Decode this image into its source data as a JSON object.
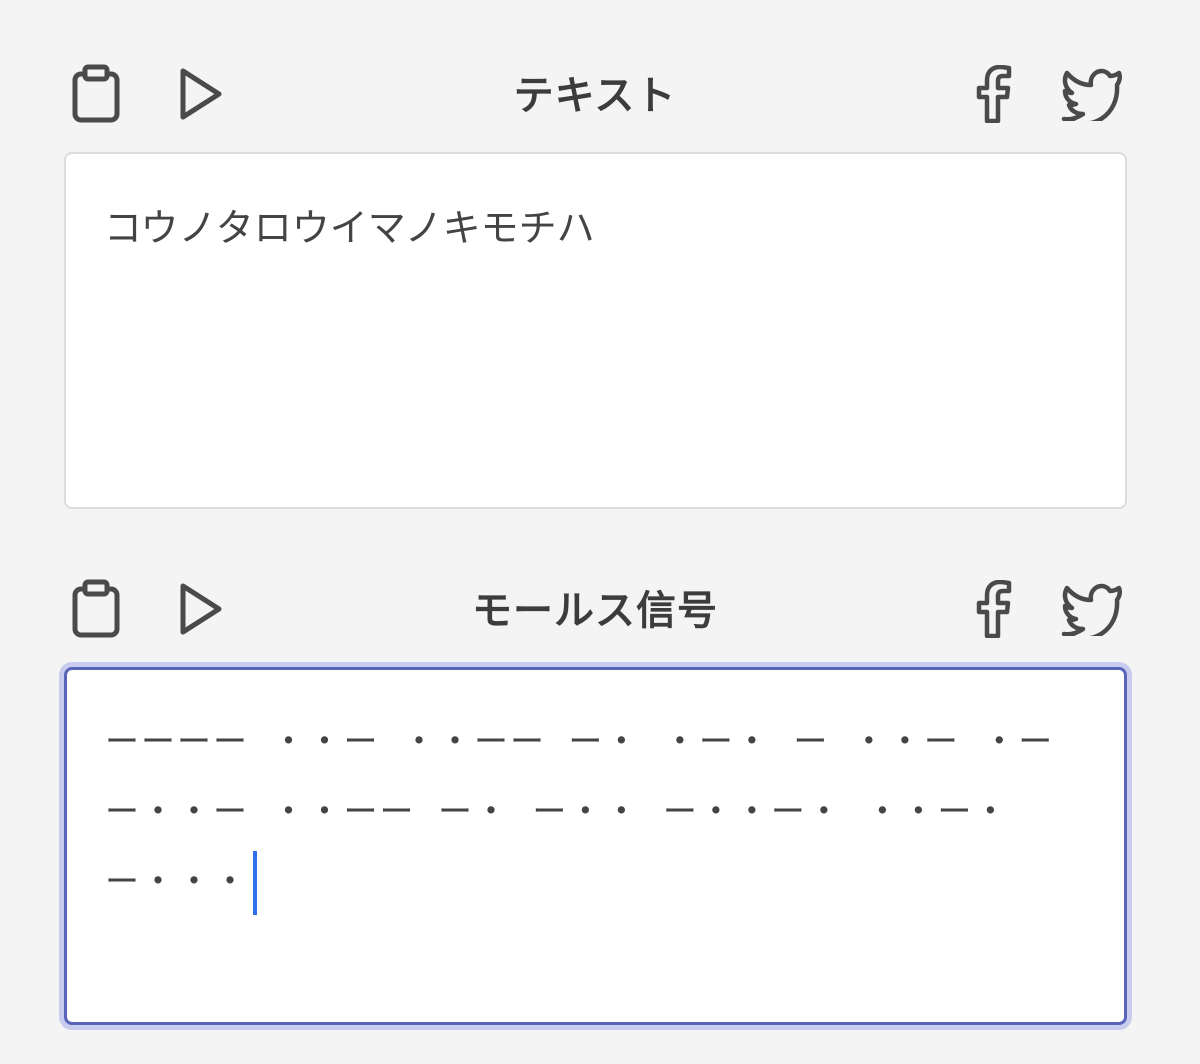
{
  "text_section": {
    "title": "テキスト",
    "content": "コウノタロウイマノキモチハ"
  },
  "morse_section": {
    "title": "モールス信号",
    "content": "ーーーー ・・ー ・・ーー ー・ ・ー・ ー ・・ー ・ー ー・・ー ・・ーー ー・ ー・・ ー・・ー・ ・・ー・ ー・・・"
  },
  "icons": {
    "clipboard": "clipboard-icon",
    "play": "play-icon",
    "facebook": "facebook-icon",
    "twitter": "twitter-icon"
  },
  "colors": {
    "background": "#f4f4f4",
    "focus_border": "#5a64b8",
    "focus_glow": "#c8cdf0",
    "caret": "#2f6fe8",
    "icon": "#4a4a4a"
  }
}
